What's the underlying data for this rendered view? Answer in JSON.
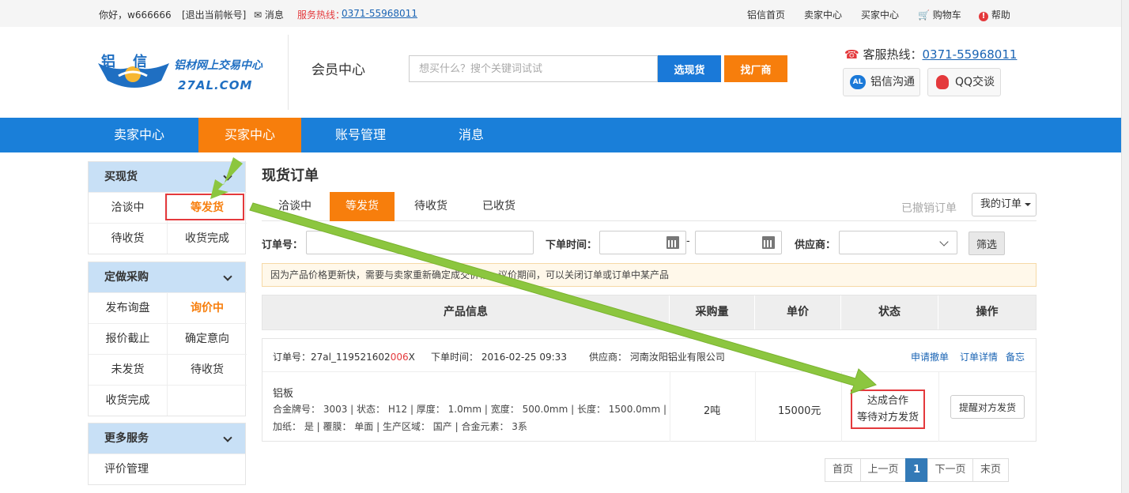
{
  "topbar": {
    "greeting": "你好，w666666",
    "logout": "[退出当前帐号]",
    "message": "✉ 消息",
    "hotline_label": "服务热线：",
    "hotline_number": "0371-55968011",
    "links": [
      "铝信首页",
      "卖家中心",
      "买家中心",
      "购物车",
      "帮助"
    ]
  },
  "header": {
    "logo_title": "铝信",
    "logo_cn": "铝材网上交易中心",
    "logo_en": "27AL.COM",
    "member_center": "会员中心",
    "search_placeholder": "想买什么？搜个关键词试试",
    "btn_stock": "选现货",
    "btn_factory": "找厂商",
    "hotline_label": "客服热线：",
    "hotline_number": "0371-55968011",
    "chat_al": "铝信沟通",
    "chat_al_badge": "AL",
    "chat_qq": "QQ交谈"
  },
  "nav": {
    "items": [
      "卖家中心",
      "买家中心",
      "账号管理",
      "消息"
    ]
  },
  "sidebar": {
    "s1": {
      "title": "买现货",
      "items": [
        "洽谈中",
        "等发货",
        "待收货",
        "收货完成"
      ]
    },
    "s2": {
      "title": "定做采购",
      "items": [
        "发布询盘",
        "询价中",
        "报价截止",
        "确定意向",
        "未发货",
        "待收货",
        "收货完成"
      ]
    },
    "s3": {
      "title": "更多服务",
      "items": [
        "评价管理"
      ]
    }
  },
  "main": {
    "title": "现货订单",
    "tabs": [
      "洽谈中",
      "等发货",
      "待收货",
      "已收货"
    ],
    "cancelled": "已撤销订单",
    "my_orders": "我的订单",
    "filter": {
      "order_no": "订单号：",
      "order_time": "下单时间：",
      "supplier": "供应商：",
      "dash": "-",
      "btn": "筛选"
    },
    "notice": "因为产品价格更新快，需要与卖家重新确定成交价格。议价期间，可以关闭订单或订单中某产品",
    "columns": [
      "产品信息",
      "采购量",
      "单价",
      "状态",
      "操作"
    ],
    "order": {
      "no_label": "订单号：",
      "no_a": "27al_119521602",
      "no_b": "006",
      "no_c": "X",
      "time": "下单时间： 2016-02-25 09:33",
      "supplier": "供应商： 河南汝阳铝业有限公司",
      "actions": [
        "申请撤单",
        "订单详情",
        "备忘"
      ],
      "product": "铝板",
      "line1": "合金牌号： 3003 | 状态： H12 | 厚度： 1.0mm | 宽度： 500.0mm | 长度： 1500.0mm |",
      "line2": "加纸： 是 | 覆膜： 单面 | 生产区域： 国产 | 合金元素： 3系",
      "qty": "2吨",
      "price": "15000元",
      "status1": "达成合作",
      "status2": "等待对方发货",
      "remind": "提醒对方发货"
    },
    "pager": [
      "首页",
      "上一页",
      "1",
      "下一页",
      "末页"
    ]
  },
  "colors": {
    "brand_blue": "#1a7fd9",
    "accent_orange": "#f77e0c",
    "highlight_red": "#e4393c",
    "arrow_green": "#8cc63f"
  }
}
